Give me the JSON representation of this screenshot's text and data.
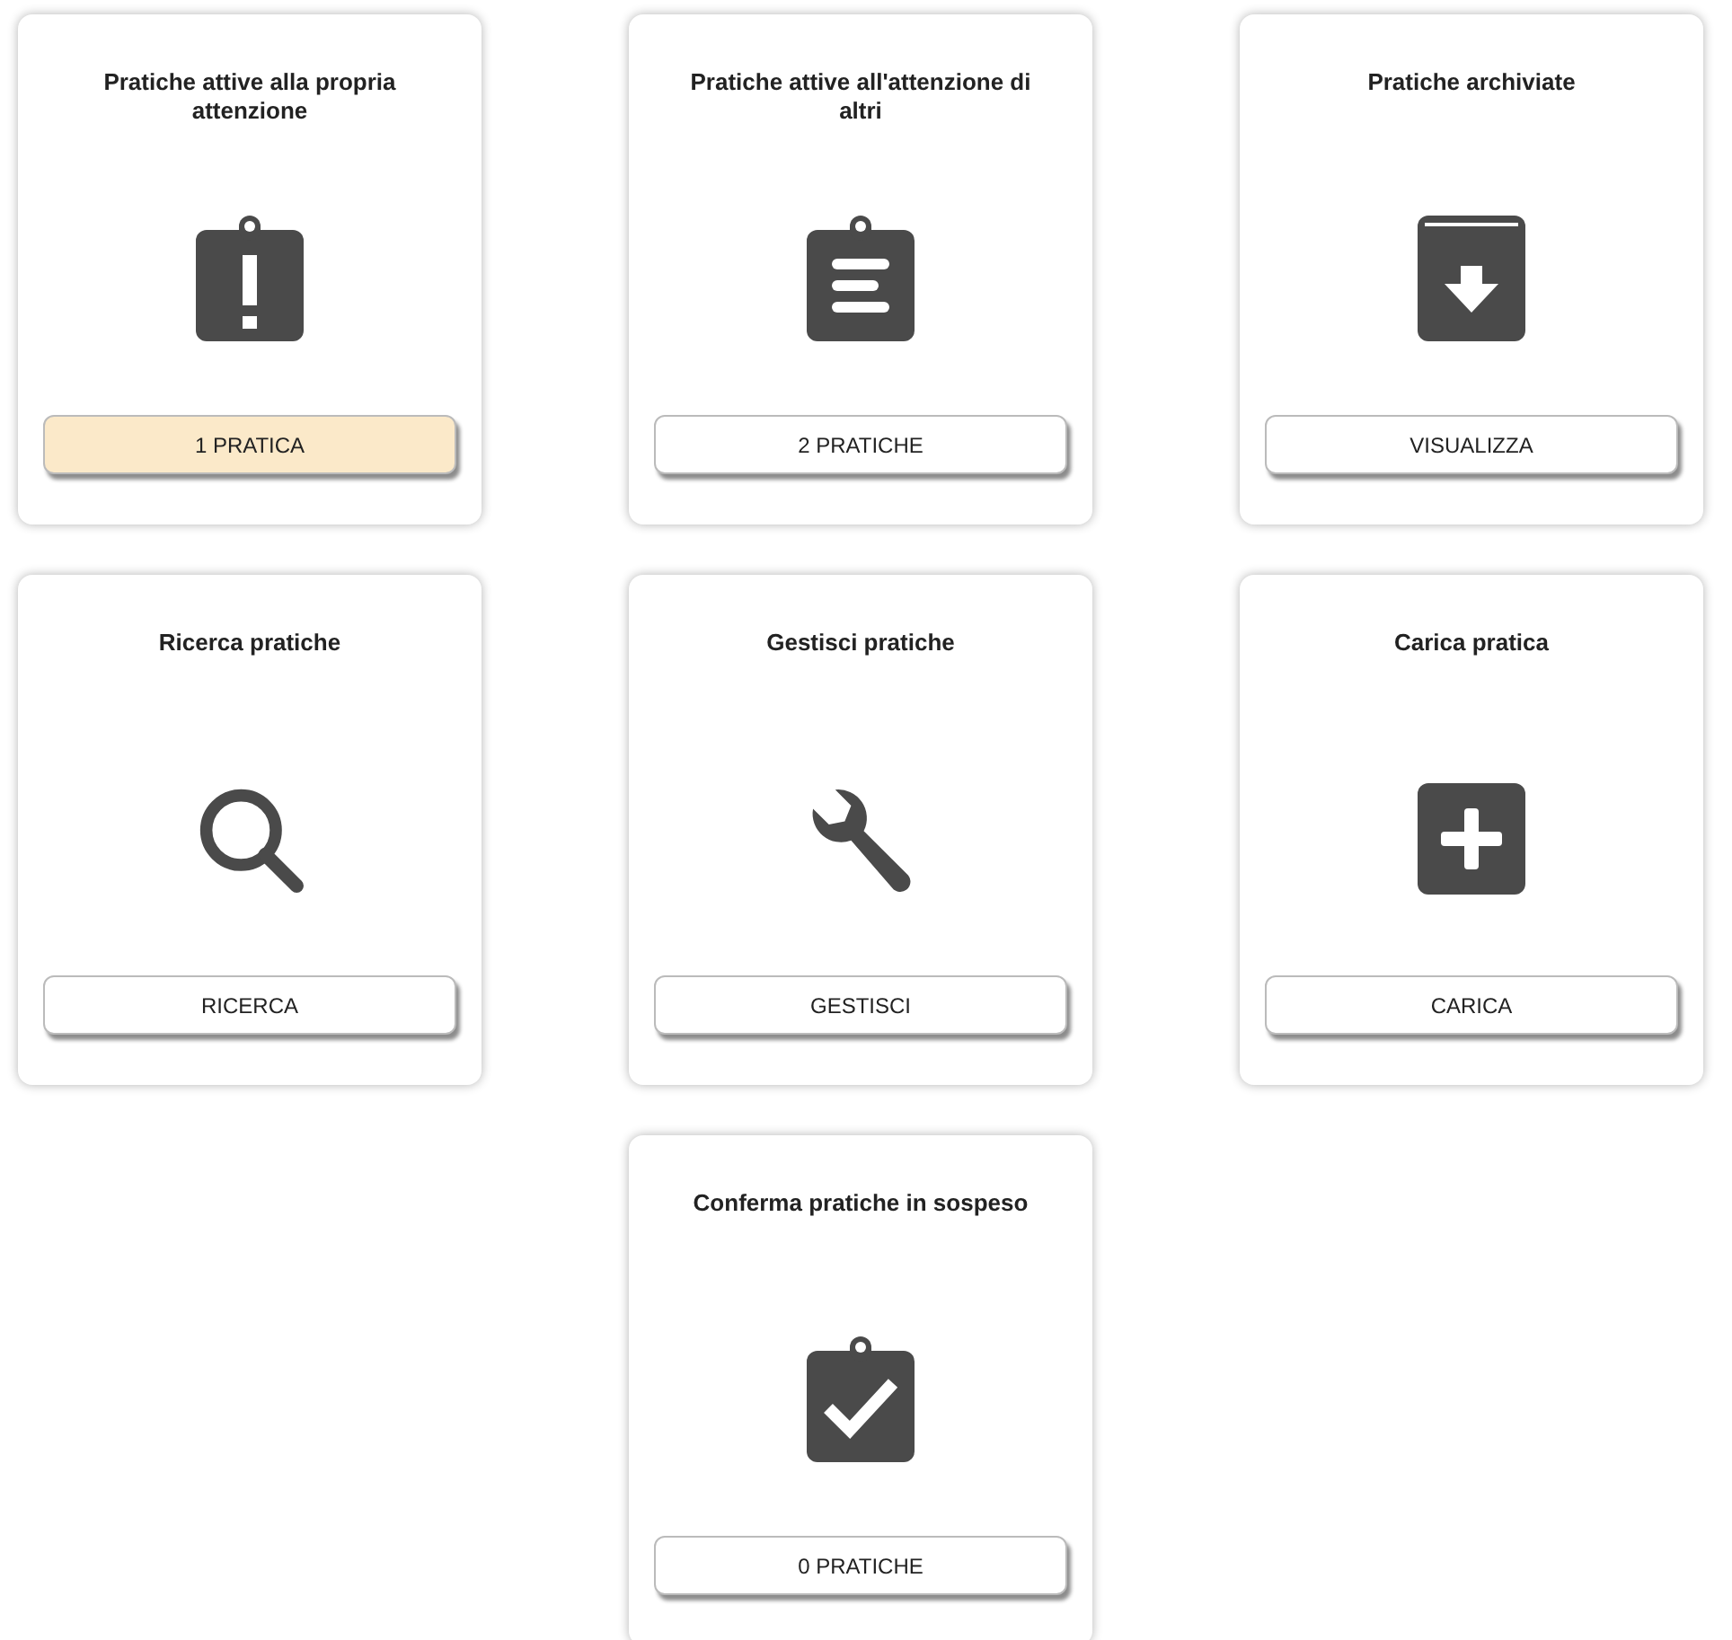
{
  "cards": [
    {
      "title": "Pratiche attive alla propria attenzione",
      "kind": "clipboard-alert",
      "button": "1 PRATICA",
      "highlighted": true
    },
    {
      "title": "Pratiche attive all'attenzione di altri",
      "kind": "clipboard-list",
      "button": "2 PRATICHE",
      "highlighted": false
    },
    {
      "title": "Pratiche archiviate",
      "kind": "archive",
      "button": "VISUALIZZA",
      "highlighted": false
    },
    {
      "title": "Ricerca pratiche",
      "kind": "search",
      "button": "RICERCA",
      "highlighted": false
    },
    {
      "title": "Gestisci pratiche",
      "kind": "wrench",
      "button": "GESTISCI",
      "highlighted": false
    },
    {
      "title": "Carica pratica",
      "kind": "plus",
      "button": "CARICA",
      "highlighted": false
    },
    {
      "title": "Conferma pratiche in sospeso",
      "kind": "clipboard-check",
      "button": "0 PRATICHE",
      "highlighted": false
    }
  ]
}
